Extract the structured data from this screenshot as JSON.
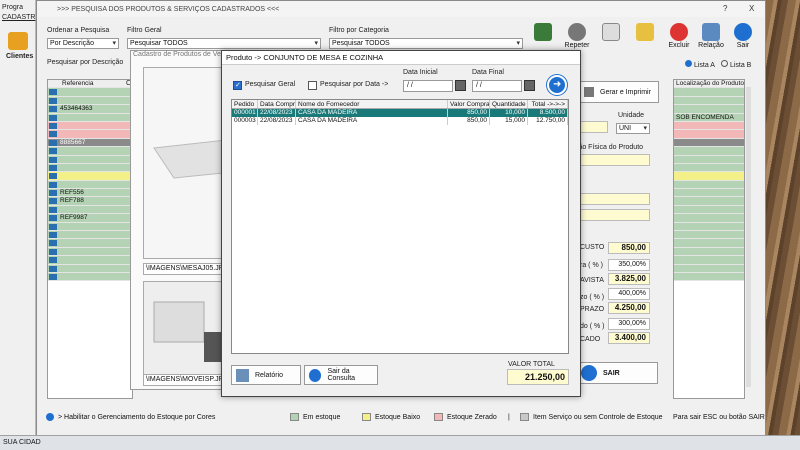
{
  "taskbar": {
    "text": "SUA CIDAD"
  },
  "left_strip": {
    "prog": "Progra",
    "cad": "CADASTR",
    "clientes": "Clientes"
  },
  "window": {
    "title": ">>>  PESQUISA DOS PRODUTOS & SERVIÇOS CADASTRADOS  <<<",
    "help": "?",
    "close": "X"
  },
  "filters": {
    "ordenar_label": "Ordenar a Pesquisa",
    "ordenar_value": "Por Descrição",
    "filtro_geral_label": "Filtro Geral",
    "filtro_geral_value": "Pesquisar TODOS",
    "filtro_cat_label": "Filtro por Categoria",
    "filtro_cat_value": "Pesquisar TODOS",
    "pesquisar_por": "Pesquisar por Descrição"
  },
  "toolbar": {
    "btn1": "",
    "btn2": "Repeter",
    "btn3": "",
    "excluir": "Excluir",
    "relacao": "Relação",
    "sair": "Sair"
  },
  "lists": {
    "a": "Lista A",
    "b": "Lista B"
  },
  "main_grid": {
    "col_ref": "Referencia",
    "col_c": "C",
    "refs": [
      "",
      "",
      "453464363",
      "",
      "",
      "",
      "8885667",
      "",
      "",
      "",
      "",
      "",
      "REF556",
      "REF788",
      "",
      "REF9987",
      "",
      "",
      "",
      "",
      "",
      "",
      ""
    ]
  },
  "right_panel": {
    "localizacao": "Localização do Produto",
    "sob_encomenda": "SOB ENCOMENDA",
    "gerar": "Gerar e Imprimir",
    "unidade_label": "Unidade",
    "unidade_value": "UNI",
    "loc_fisica": "ização Física do Produto",
    "custo_label": "CUSTO",
    "custo": "850,00",
    "ra_label": "ra ( % )",
    "pct1": "350,00%",
    "avista_label": "AVISTA",
    "avista": "3.825,00",
    "zo_label": "zo ( % )",
    "pct2": "400,00%",
    "prazo_label": "PRAZO",
    "prazo": "4.250,00",
    "do_label": "do ( % )",
    "pct3": "300,00%",
    "cado_label": "CADO",
    "cado": "3.400,00",
    "sair": "SAIR"
  },
  "sub": {
    "title": "Cadastro de Produtos de Ve",
    "img1_path": "\\IMAGENS\\MESAJ05.JPG",
    "img2_path": "\\IMAGENS\\MOVEISP.JPG"
  },
  "dialog": {
    "title": "Produto -> CONJUNTO DE MESA E COZINHA",
    "pesquisar_geral": "Pesquisar Geral",
    "pesquisar_data": "Pesquisar por Data  ->",
    "data_inicial_label": "Data Inicial",
    "data_inicial": "/ /",
    "data_final_label": "Data Final",
    "data_final": "/ /",
    "headers": [
      "Pedido",
      "Data Compra",
      "Nome do Fornecedor",
      "Valor Compra",
      "Quantidade",
      "Total ->->->"
    ],
    "rows": [
      [
        "000001",
        "22/08/2023",
        "CASA DA MADEIRA",
        "850,00",
        "10,000",
        "8.500,00"
      ],
      [
        "000003",
        "22/08/2023",
        "CASA DA MADEIRA",
        "850,00",
        "15,000",
        "12.750,00"
      ]
    ],
    "relatorio": "Relatório",
    "sair_consulta": "Sair da Consulta",
    "valor_total_label": "VALOR TOTAL",
    "valor_total": "21.250,00"
  },
  "legend": {
    "habilitar": "> Habilitar o Gerenciamento do Estoque por Cores",
    "em_estoque": "Em estoque",
    "estoque_baixo": "Estoque Baixo",
    "estoque_zerado": "Estoque Zerado",
    "sep": "|",
    "item_servico": "Item Serviço ou sem Controle de Estoque",
    "para_sair": "Para sair ESC ou botão SAIR"
  },
  "colors": {
    "em_estoque": "#b4d2b4",
    "baixo": "#f4f089",
    "zerado": "#f2b8b8",
    "servico": "#c8c8c8",
    "accent": "#1f6fd1",
    "selected": "#1a7a7a"
  }
}
